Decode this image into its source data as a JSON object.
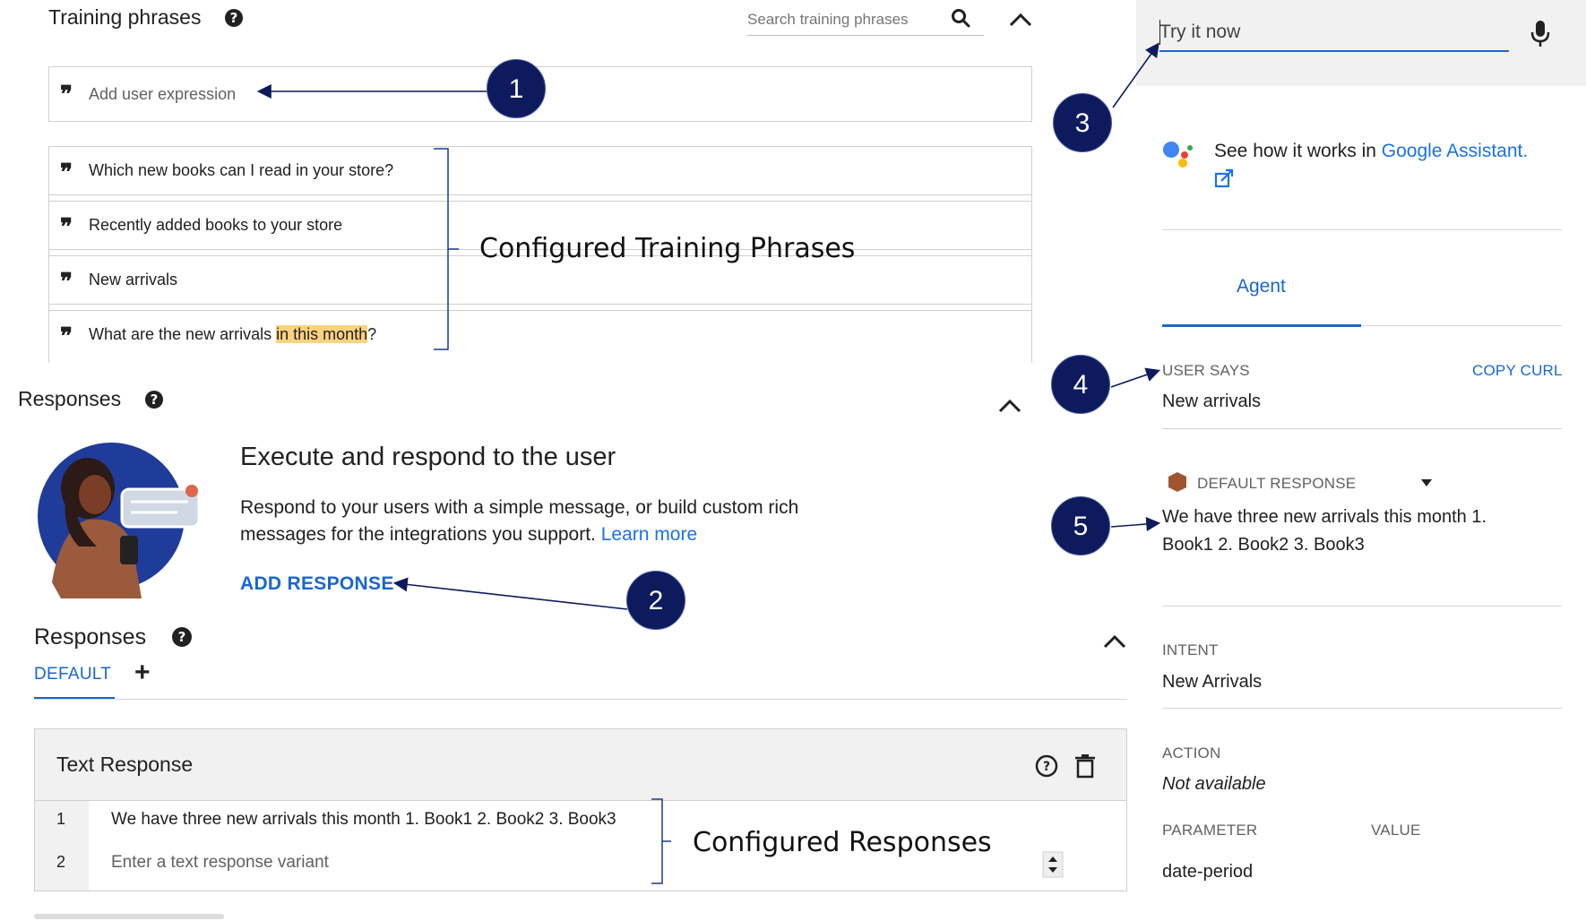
{
  "training": {
    "title": "Training phrases",
    "search_placeholder": "Search training phrases",
    "add_placeholder": "Add user expression",
    "phrases": [
      {
        "before": "Which new books can I read in your store?",
        "highlight": "",
        "after": ""
      },
      {
        "before": "Recently added books to your store",
        "highlight": "",
        "after": ""
      },
      {
        "before": "New arrivals",
        "highlight": "",
        "after": ""
      },
      {
        "before": "What are the new arrivals ",
        "highlight": "in this month",
        "after": "?"
      }
    ],
    "annotation": "Configured Training Phrases"
  },
  "responses_intro": {
    "title": "Responses",
    "heading": "Execute and respond to the user",
    "body": "Respond to your users with a simple message, or build custom rich messages for the integrations you support.",
    "learn_more": "Learn more",
    "add_response": "ADD RESPONSE"
  },
  "responses": {
    "title": "Responses",
    "tab_default": "DEFAULT",
    "add_tab": "+",
    "card_title": "Text Response",
    "rows": [
      {
        "num": "1",
        "text": "We have three new arrivals this month 1. Book1 2. Book2 3. Book3"
      },
      {
        "num": "2",
        "text": "Enter a text response variant"
      }
    ],
    "annotation": "Configured Responses"
  },
  "try_panel": {
    "input_placeholder": "Try it now",
    "assistant_prefix": "See how it works in ",
    "assistant_link": "Google Assistant.",
    "tab_agent": "Agent",
    "user_says_label": "USER SAYS",
    "copy_curl": "COPY CURL",
    "user_says_value": "New arrivals",
    "default_response_label": "DEFAULT RESPONSE",
    "default_response_value_line1": "We have three new arrivals this month 1.",
    "default_response_value_line2": "Book1 2. Book2 3. Book3",
    "intent_label": "INTENT",
    "intent_value": "New Arrivals",
    "action_label": "ACTION",
    "action_value": "Not available",
    "parameter_label": "PARAMETER",
    "value_label": "VALUE",
    "parameter_value": "date-period"
  },
  "callouts": [
    "1",
    "2",
    "3",
    "4",
    "5"
  ],
  "colors": {
    "callout_fill": "#0d1b5e",
    "link_blue": "#1a73e8",
    "highlight": "#fbd27e"
  },
  "icons": [
    "help-icon",
    "search-icon",
    "chevron-up-icon",
    "quote-icon",
    "microphone-icon",
    "assistant-logo-icon",
    "external-link-icon",
    "hexagon-icon",
    "caret-down-icon",
    "delete-icon",
    "plus-icon",
    "stepper-icon"
  ]
}
